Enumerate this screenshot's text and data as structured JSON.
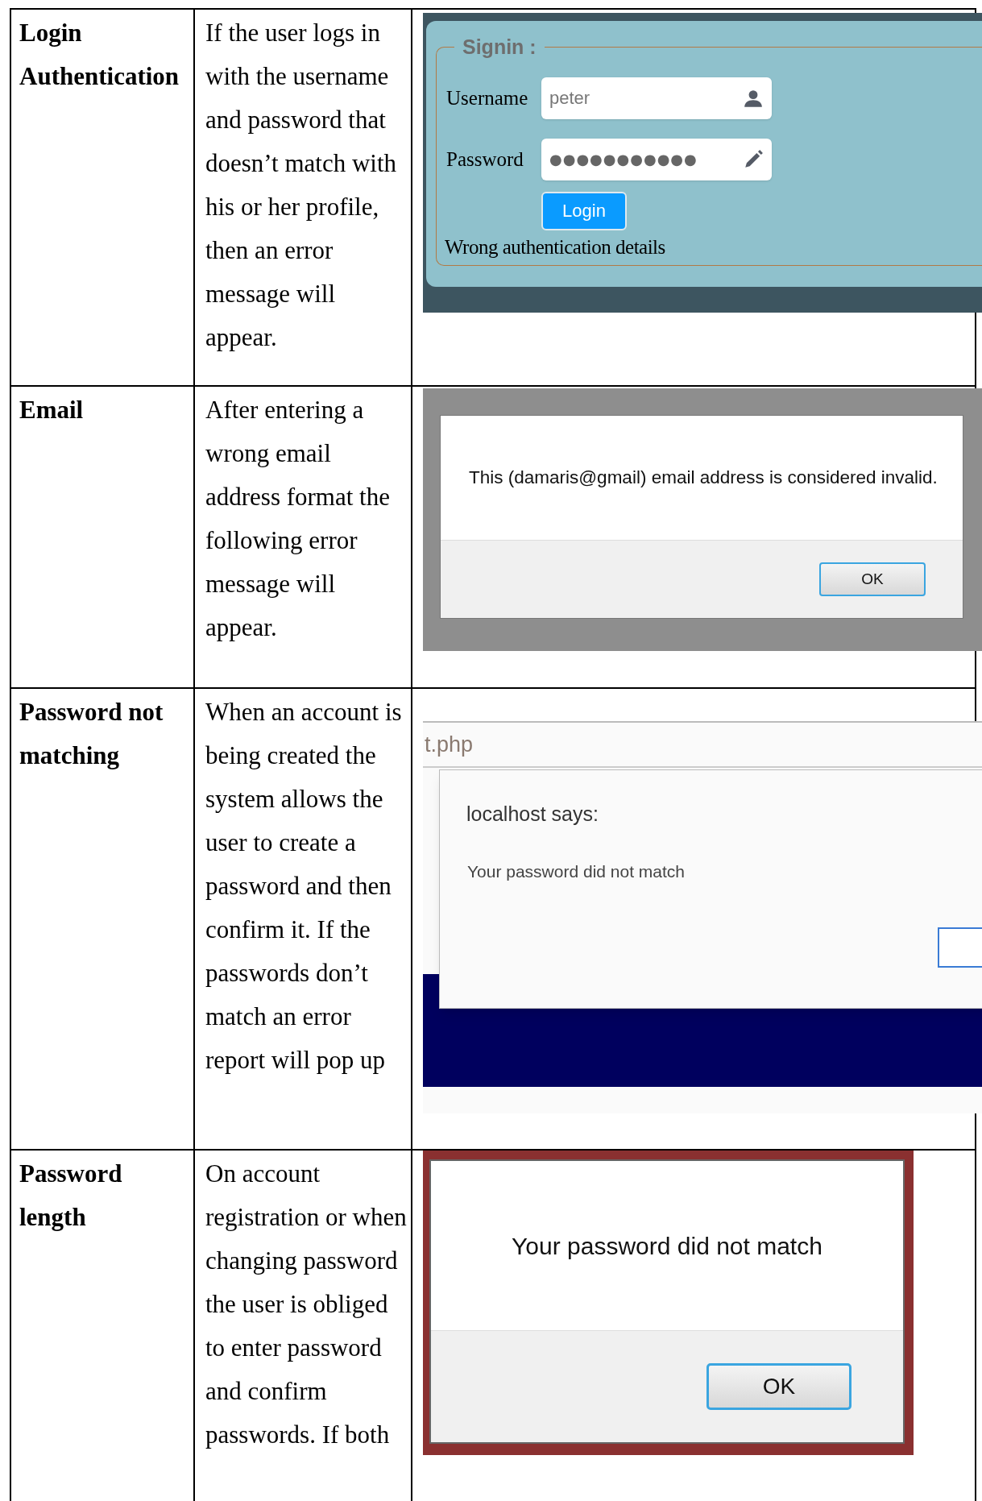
{
  "rows": [
    {
      "feature": "Login Authentication",
      "description": "If the user logs in with the username and password that doesn’t match with his or her profile, then an error message will appear.",
      "screenshot": {
        "kind": "signin",
        "legend": "Signin :",
        "fields": [
          {
            "kind": "text",
            "label": "Username",
            "value": "peter"
          },
          {
            "kind": "password",
            "label": "Password",
            "value": "●●●●●●●●●●●"
          }
        ],
        "button": "Login",
        "message": "Wrong authentication details"
      }
    },
    {
      "feature": "Email",
      "description": "After entering a wrong email address format the following error message will appear.",
      "screenshot": {
        "kind": "alert",
        "message": "This (damaris@gmail) email address is considered invalid.",
        "button": "OK"
      }
    },
    {
      "feature": "Password not matching",
      "description": "When an account is being created the system allows the user to create a password and then confirm it. If the passwords don’t match an error report will pop up",
      "screenshot": {
        "kind": "browser_alert",
        "address": "t.php",
        "title": "localhost says:",
        "message": "Your password did not match"
      }
    },
    {
      "feature": "Password length",
      "description": "On account registration or when changing password the user is obliged to enter password and confirm passwords. If both",
      "screenshot": {
        "kind": "alert_large",
        "message": "Your password did not match",
        "button": "OK"
      }
    }
  ]
}
